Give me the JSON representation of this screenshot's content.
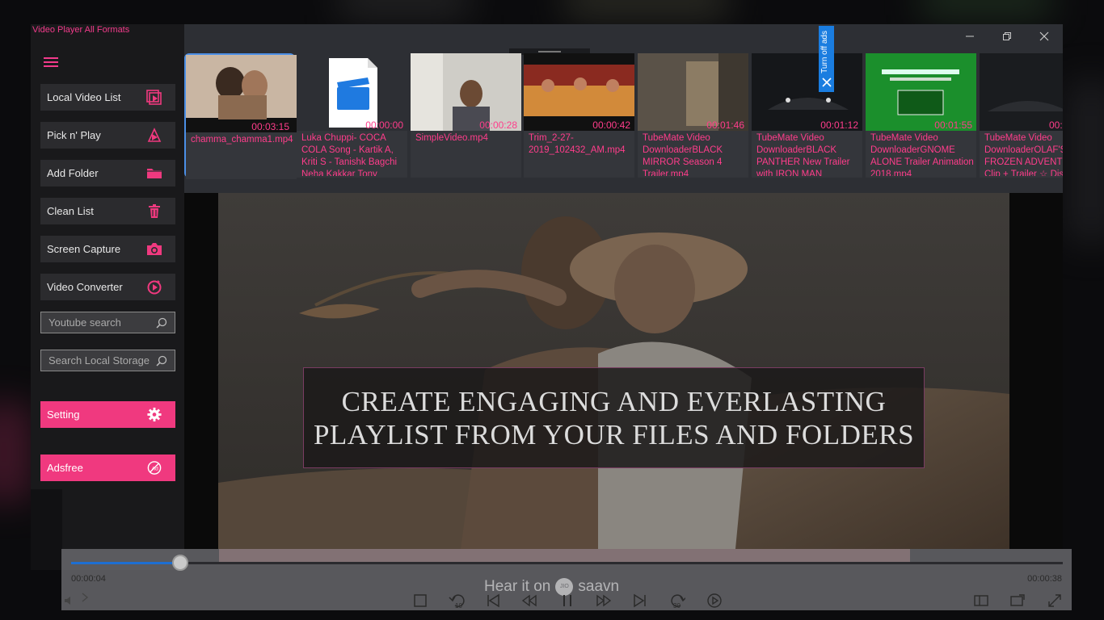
{
  "app": {
    "title": "Video Player All Formats"
  },
  "sidebar": {
    "items": [
      {
        "label": "Local Video List",
        "icon": "video-list-icon"
      },
      {
        "label": "Pick n' Play",
        "icon": "pick-play-icon"
      },
      {
        "label": "Add Folder",
        "icon": "folder-icon"
      },
      {
        "label": "Clean List",
        "icon": "trash-icon"
      },
      {
        "label": "Screen Capture",
        "icon": "camera-icon"
      },
      {
        "label": "Video Converter",
        "icon": "convert-icon"
      }
    ],
    "youtube_search": {
      "placeholder": "Youtube search"
    },
    "local_search": {
      "placeholder": "Search Local Storage"
    },
    "setting_label": "Setting",
    "adsfree_label": "Adsfree"
  },
  "playlist": {
    "ad_label": "Turn off ads",
    "items": [
      {
        "name": "chamma_chamma1.mp4",
        "duration": "00:03:15",
        "selected": true
      },
      {
        "name": "Luka Chuppi- COCA COLA Song - Kartik A, Kriti S - Tanishk Bagchi Neha Kakkar Tony",
        "duration": "00:00:00",
        "selected": false
      },
      {
        "name": "SimpleVideo.mp4",
        "duration": "00:00:28",
        "selected": false
      },
      {
        "name": "Trim_2-27-2019_102432_AM.mp4",
        "duration": "00:00:42",
        "selected": false
      },
      {
        "name": "TubeMate Video DownloaderBLACK MIRROR Season 4 Trailer.mp4",
        "duration": "00:01:46",
        "selected": false
      },
      {
        "name": "TubeMate Video DownloaderBLACK PANTHER New Trailer with IRON MAN",
        "duration": "00:01:12",
        "selected": false
      },
      {
        "name": "TubeMate Video DownloaderGNOME ALONE Trailer Animation 2018.mp4",
        "duration": "00:01:55",
        "selected": false
      },
      {
        "name": "TubeMate Video DownloaderOLAF'S FROZEN ADVENTURE Clip + Trailer ☆ Disney",
        "duration": "00:",
        "selected": false
      }
    ]
  },
  "video": {
    "caption_line1": "CREATE ENGAGING AND EVERLASTING",
    "caption_line2": "PLAYLIST FROM YOUR FILES AND FOLDERS"
  },
  "player": {
    "current_time": "00:00:04",
    "total_time": "00:00:38",
    "progress": 0.11,
    "watermark_prefix": "Hear it on",
    "watermark_jio": "JIO",
    "watermark_brand": "saavn"
  },
  "colors": {
    "accent": "#f0397f",
    "pink_text": "#ff3d8b",
    "selection": "#4b8fe6",
    "progress": "#1e6fd2"
  }
}
